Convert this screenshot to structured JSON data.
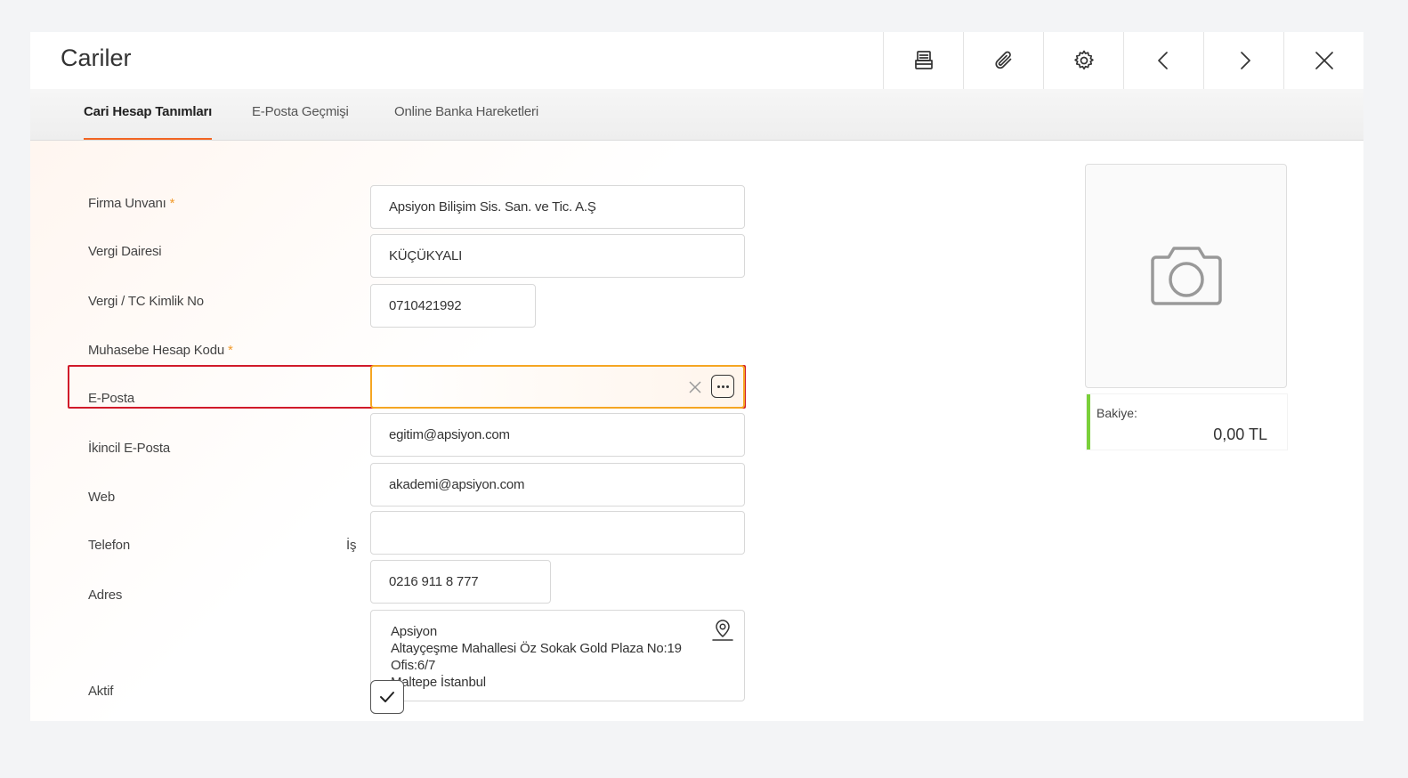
{
  "window": {
    "title": "Cariler",
    "toolbar": [
      {
        "name": "print-button",
        "icon": "print-icon"
      },
      {
        "name": "attach-button",
        "icon": "paperclip-icon"
      },
      {
        "name": "settings-button",
        "icon": "gear-icon"
      },
      {
        "name": "previous-button",
        "icon": "chevron-left-icon"
      },
      {
        "name": "next-button",
        "icon": "chevron-right-icon"
      },
      {
        "name": "close-button",
        "icon": "close-icon"
      }
    ]
  },
  "tabs": [
    {
      "label": "Cari Hesap Tanımları",
      "active": true
    },
    {
      "label": "E-Posta Geçmişi",
      "active": false
    },
    {
      "label": "Online Banka Hareketleri",
      "active": false
    }
  ],
  "form": {
    "firma_unvani": {
      "label": "Firma Unvanı",
      "required_mark": "*",
      "value": "Apsiyon Bilişim Sis. San. ve Tic. A.Ş"
    },
    "vergi_dairesi": {
      "label": "Vergi Dairesi",
      "value": "KÜÇÜKYALI"
    },
    "vergi_no": {
      "label": "Vergi / TC Kimlik No",
      "value": "0710421992"
    },
    "muhasebe_kodu": {
      "label": "Muhasebe Hesap Kodu",
      "required_mark": "*",
      "value": ""
    },
    "eposta": {
      "label": "E-Posta",
      "value": "egitim@apsiyon.com"
    },
    "ikincil_eposta": {
      "label": "İkincil E-Posta",
      "value": "akademi@apsiyon.com"
    },
    "web": {
      "label": "Web",
      "value": ""
    },
    "telefon": {
      "label": "Telefon",
      "type_label": "İş",
      "value": "0216 911 8 777"
    },
    "adres": {
      "label": "Adres",
      "lines": [
        "Apsiyon",
        "Altayçeşme Mahallesi Öz Sokak Gold Plaza No:19",
        "Ofis:6/7",
        "Maltepe İstanbul"
      ]
    },
    "aktif": {
      "label": "Aktif",
      "checked": true
    }
  },
  "sidebar": {
    "photo_icon": "camera-icon",
    "balance_label": "Bakiye:",
    "balance_value": "0,00 TL",
    "balance_accent": "#7ad03a"
  },
  "colors": {
    "active_tab_underline": "#f26522",
    "required_mark": "#f29b2c",
    "error_border": "#d11a2a",
    "focus_border": "#f5a623"
  }
}
